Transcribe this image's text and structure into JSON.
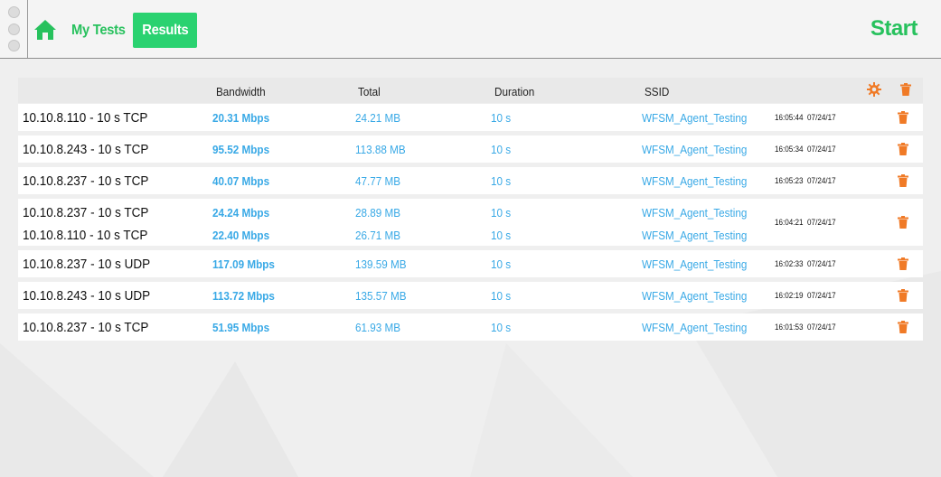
{
  "nav": {
    "home_icon": "home-icon",
    "my_tests": "My Tests",
    "results": "Results",
    "start": "Start"
  },
  "colors": {
    "accent_green": "#2ad270",
    "link_blue": "#39a9e6",
    "delete_orange": "#f07a26"
  },
  "table": {
    "columns": [
      "Bandwidth",
      "Total",
      "Duration",
      "SSID"
    ],
    "settings_icon": "gear-icon",
    "delete_all_icon": "trash-icon",
    "groups": [
      {
        "time": "16:05:44",
        "date": "07/24/17",
        "tests": [
          {
            "name": "10.10.8.110 - 10 s TCP",
            "bandwidth": "20.31 Mbps",
            "total": "24.21 MB",
            "duration": "10 s",
            "ssid": "WFSM_Agent_Testing"
          }
        ]
      },
      {
        "time": "16:05:34",
        "date": "07/24/17",
        "tests": [
          {
            "name": "10.10.8.243 - 10 s TCP",
            "bandwidth": "95.52 Mbps",
            "total": "113.88 MB",
            "duration": "10 s",
            "ssid": "WFSM_Agent_Testing"
          }
        ]
      },
      {
        "time": "16:05:23",
        "date": "07/24/17",
        "tests": [
          {
            "name": "10.10.8.237 - 10 s TCP",
            "bandwidth": "40.07 Mbps",
            "total": "47.77 MB",
            "duration": "10 s",
            "ssid": "WFSM_Agent_Testing"
          }
        ]
      },
      {
        "time": "16:04:21",
        "date": "07/24/17",
        "tests": [
          {
            "name": "10.10.8.237 - 10 s TCP",
            "bandwidth": "24.24 Mbps",
            "total": "28.89 MB",
            "duration": "10 s",
            "ssid": "WFSM_Agent_Testing"
          },
          {
            "name": "10.10.8.110 - 10 s TCP",
            "bandwidth": "22.40 Mbps",
            "total": "26.71 MB",
            "duration": "10 s",
            "ssid": "WFSM_Agent_Testing"
          }
        ]
      },
      {
        "time": "16:02:33",
        "date": "07/24/17",
        "tests": [
          {
            "name": "10.10.8.237 - 10 s UDP",
            "bandwidth": "117.09 Mbps",
            "total": "139.59 MB",
            "duration": "10 s",
            "ssid": "WFSM_Agent_Testing"
          }
        ]
      },
      {
        "time": "16:02:19",
        "date": "07/24/17",
        "tests": [
          {
            "name": "10.10.8.243 - 10 s UDP",
            "bandwidth": "113.72 Mbps",
            "total": "135.57 MB",
            "duration": "10 s",
            "ssid": "WFSM_Agent_Testing"
          }
        ]
      },
      {
        "time": "16:01:53",
        "date": "07/24/17",
        "tests": [
          {
            "name": "10.10.8.237 - 10 s TCP",
            "bandwidth": "51.95 Mbps",
            "total": "61.93 MB",
            "duration": "10 s",
            "ssid": "WFSM_Agent_Testing"
          }
        ]
      }
    ]
  }
}
